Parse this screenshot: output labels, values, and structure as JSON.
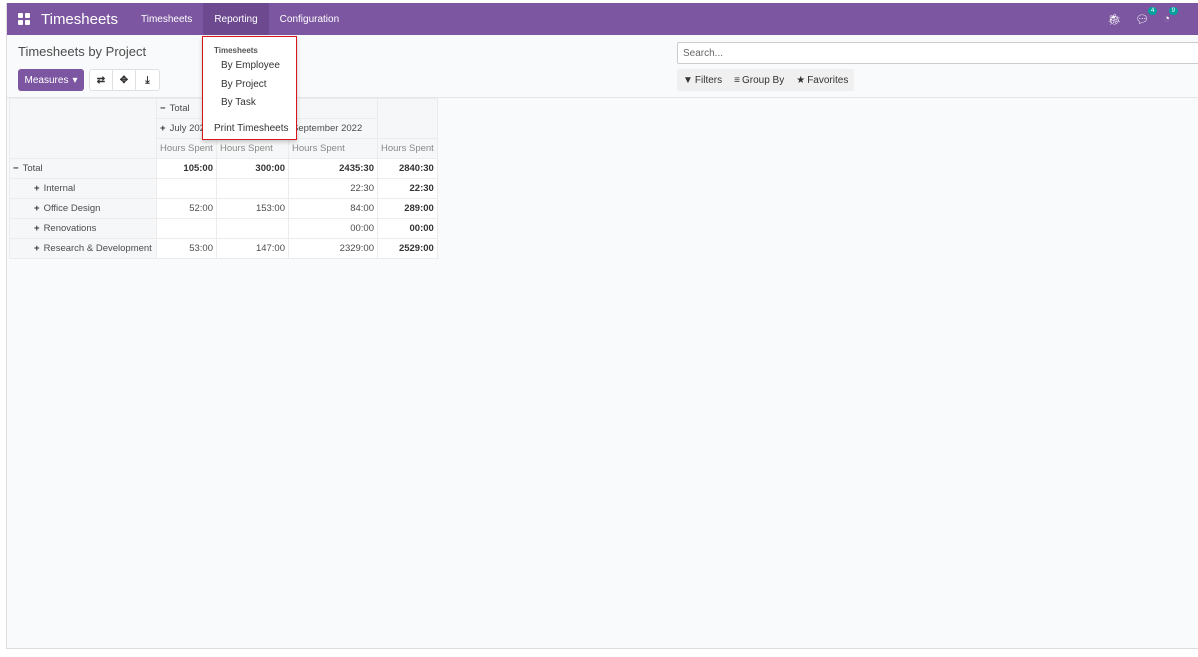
{
  "navbar": {
    "brand": "Timesheets",
    "menus": [
      "Timesheets",
      "Reporting",
      "Configuration"
    ],
    "active_menu": "Reporting",
    "chat_badge": "4",
    "activity_badge": "9",
    "color": "#7c56a0"
  },
  "page": {
    "title": "Timesheets by Project",
    "measures_label": "Measures"
  },
  "search": {
    "placeholder": "Search...",
    "filters": "Filters",
    "group_by": "Group By",
    "favorites": "Favorites"
  },
  "dropdown": {
    "section": "Timesheets",
    "items": [
      "By Employee",
      "By Project",
      "By Task"
    ],
    "print": "Print Timesheets"
  },
  "pivot": {
    "col_total": "Total",
    "col_months": [
      "July 2022",
      "",
      "September 2022"
    ],
    "measure": "Hours Spent",
    "row_total": "Total",
    "totals": [
      "105:00",
      "300:00",
      "2435:30",
      "2840:30"
    ],
    "rows": [
      {
        "label": "Internal",
        "values": [
          "",
          "",
          "22:30",
          "22:30"
        ]
      },
      {
        "label": "Office Design",
        "values": [
          "52:00",
          "153:00",
          "84:00",
          "289:00"
        ]
      },
      {
        "label": "Renovations",
        "values": [
          "",
          "",
          "00:00",
          "00:00"
        ]
      },
      {
        "label": "Research & Development",
        "values": [
          "53:00",
          "147:00",
          "2329:00",
          "2529:00"
        ]
      }
    ]
  }
}
